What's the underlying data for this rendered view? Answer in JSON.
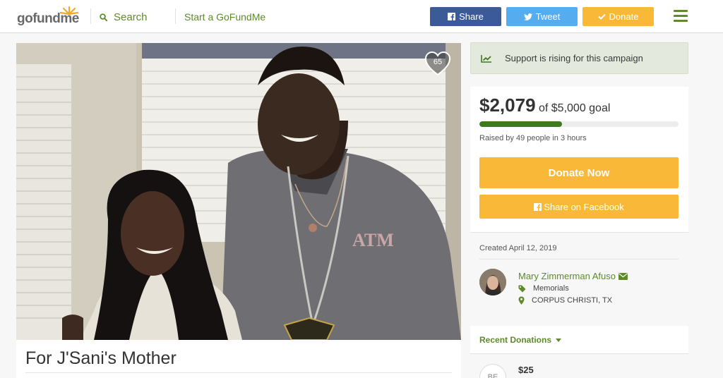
{
  "header": {
    "logo": "gofundme",
    "search_label": "Search",
    "start_label": "Start a GoFundMe",
    "share_label": "Share",
    "tweet_label": "Tweet",
    "donate_label": "Donate"
  },
  "colors": {
    "brand_green": "#5e8a2c",
    "facebook": "#3b5a9a",
    "twitter": "#55acee",
    "donate": "#f9b838",
    "progress": "#3f7a1f"
  },
  "campaign": {
    "heart_count": "65",
    "title": "For J'Sani's Mother",
    "rising_text": "Support is rising for this campaign",
    "amount": "$2,079",
    "goal_text": "of $5,000 goal",
    "progress_fraction": 0.4158,
    "raised_text": "Raised by 49 people in 3 hours",
    "donate_now_label": "Donate Now",
    "share_facebook_label": "Share on Facebook",
    "created": "Created April 12, 2019"
  },
  "organizer": {
    "name": "Mary Zimmerman Afuso",
    "category": "Memorials",
    "location": "CORPUS CHRISTI, TX"
  },
  "donations": {
    "label": "Recent Donations",
    "first_initials": "BE",
    "first_amount": "$25"
  }
}
